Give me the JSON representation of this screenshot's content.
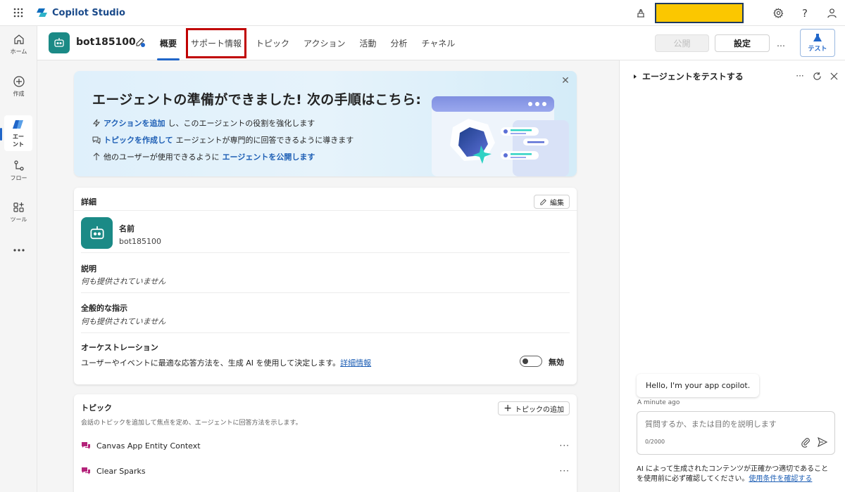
{
  "app": {
    "brand_name": "Copilot Studio"
  },
  "left_nav": [
    {
      "label": "ホーム",
      "icon": "home-icon"
    },
    {
      "label": "作成",
      "icon": "plus-circle-icon"
    },
    {
      "label": "エージェント",
      "label_line1": "エー",
      "label_line2": "ジェ",
      "label_line3": "ント",
      "icon": "agent-icon",
      "active": true
    },
    {
      "label": "フロー",
      "icon": "flow-icon"
    },
    {
      "label": "ツール",
      "icon": "tools-icon"
    },
    {
      "label": "その他",
      "icon": "more-icon"
    }
  ],
  "header": {
    "bot_name": "bot185100",
    "tabs": [
      "概要",
      "サポート情報",
      "トピック",
      "アクション",
      "活動",
      "分析",
      "チャネル"
    ],
    "active_tab": "概要",
    "highlighted_tab": "サポート情報",
    "publish_label": "公開",
    "settings_label": "設定",
    "more_label": "…",
    "test_label": "テスト"
  },
  "banner": {
    "title": "エージェントの準備ができました! 次の手順はこちら:",
    "line1_link": "アクションを追加",
    "line1_text": "し、このエージェントの役割を強化します",
    "line2_link": "トピックを作成して",
    "line2_text": "エージェントが専門的に回答できるように導きます",
    "line3_text": "他のユーザーが使用できるように",
    "line3_link": "エージェントを公開します"
  },
  "details": {
    "title": "詳細",
    "edit_label": "編集",
    "name_label": "名前",
    "name_value": "bot185100",
    "description_label": "説明",
    "description_value": "何も提供されていません",
    "instructions_label": "全般的な指示",
    "instructions_value": "何も提供されていません",
    "orchestration_label": "オーケストレーション",
    "orchestration_text": "ユーザーやイベントに最適な応答方法を、生成 AI を使用して決定します。",
    "orchestration_link": "詳細情報",
    "orchestration_state": "無効"
  },
  "topics": {
    "title": "トピック",
    "add_label": "トピックの追加",
    "subtitle": "会話のトピックを追加して焦点を定め、エージェントに回答方法を示します。",
    "items": [
      "Canvas App Entity Context",
      "Clear Sparks"
    ]
  },
  "test_pane": {
    "title": "エージェントをテストする",
    "greeting": "Hello, I'm your app copilot.",
    "timestamp": "A minute ago",
    "input_placeholder": "質問するか、または目的を説明します",
    "char_count": "0/2000",
    "disclaimer": "AI によって生成されたコンテンツが正確かつ適切であることを使用前に必ず確認してください。",
    "disclaimer_link": "使用条件を確認する"
  },
  "colors": {
    "accent": "#2066c9",
    "bot_avatar": "#1b8a86",
    "highlight_outline": "#c00000",
    "env_redaction": "#fbc700"
  }
}
